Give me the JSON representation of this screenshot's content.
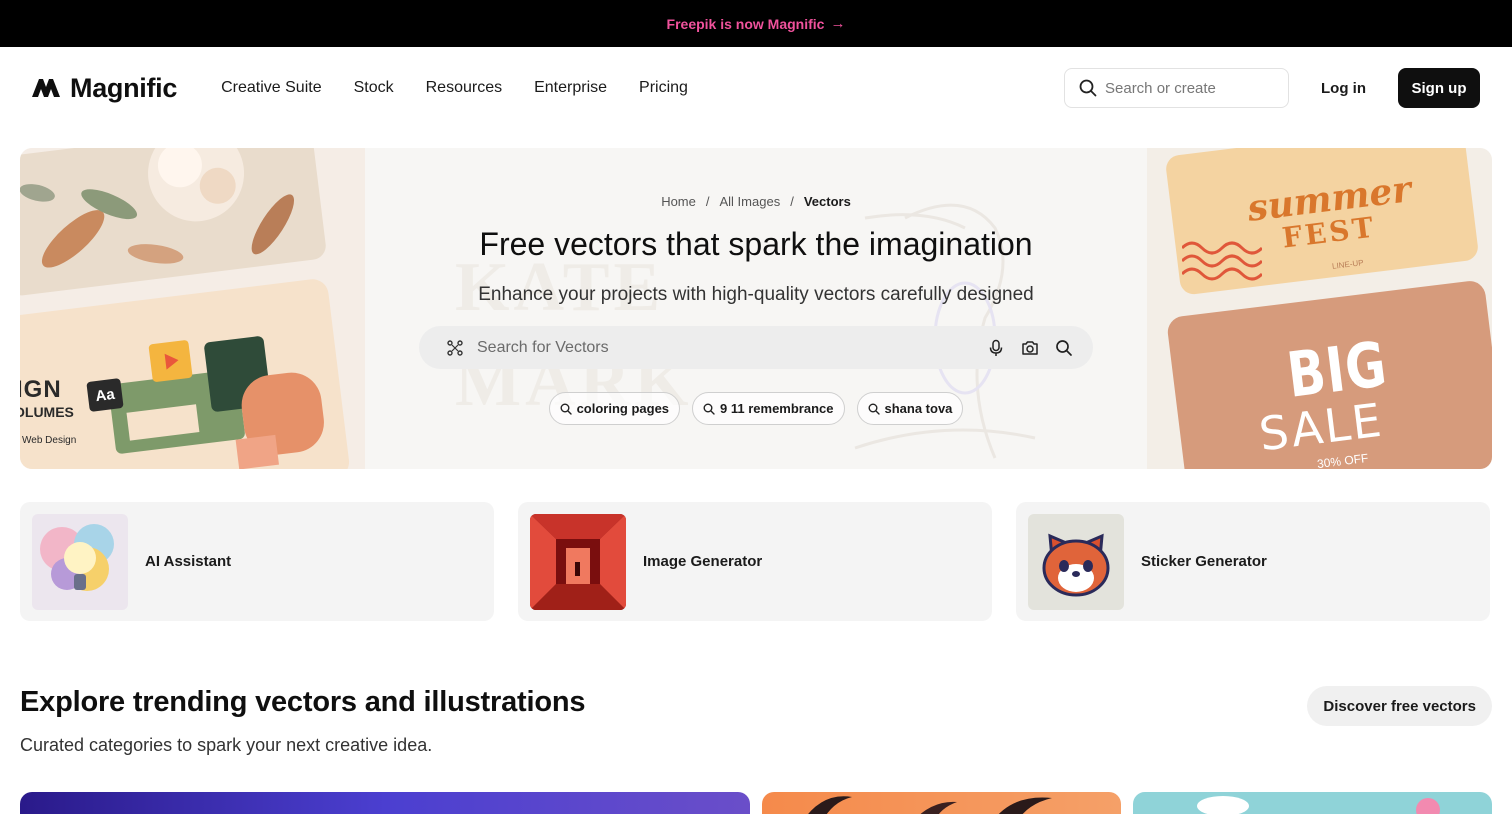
{
  "announcement": {
    "text": "Freepik is now Magnific",
    "arrow": "→"
  },
  "header": {
    "logo_text": "Magnific",
    "nav": [
      "Creative Suite",
      "Stock",
      "Resources",
      "Enterprise",
      "Pricing"
    ],
    "search_placeholder": "Search or create",
    "login_label": "Log in",
    "signup_label": "Sign up"
  },
  "hero": {
    "breadcrumb": [
      "Home",
      "All Images",
      "Vectors"
    ],
    "breadcrumb_sep": "/",
    "title": "Free vectors that spark the imagination",
    "subtitle": "Enhance your projects with high-quality vectors carefully designed",
    "search_placeholder": "Search for Vectors",
    "chips": [
      "coloring pages",
      "9 11 remembrance",
      "shana tova"
    ],
    "left_art": {
      "big_text_1": "IGN",
      "big_text_2": "OLUMES",
      "badge": "Aa",
      "caption": "Web Design"
    },
    "right_art": {
      "line1": "summer",
      "line2": "FEST",
      "line3": "LINE-UP",
      "sale1": "BIG",
      "sale2": "SALE",
      "sale3": "30% OFF"
    },
    "watermark_1": "KATE",
    "watermark_2": "MARK"
  },
  "tools": [
    {
      "label": "AI Assistant",
      "icon": "lightbulb-art"
    },
    {
      "label": "Image Generator",
      "icon": "red-corridor-art"
    },
    {
      "label": "Sticker Generator",
      "icon": "red-panda-art"
    }
  ],
  "explore": {
    "title": "Explore trending vectors and illustrations",
    "subtitle": "Curated categories to spark your next creative idea.",
    "cta": "Discover free vectors"
  },
  "colors": {
    "accent": "#f0529c",
    "dark": "#0f0f0f",
    "card_bg": "#f4f4f4"
  }
}
